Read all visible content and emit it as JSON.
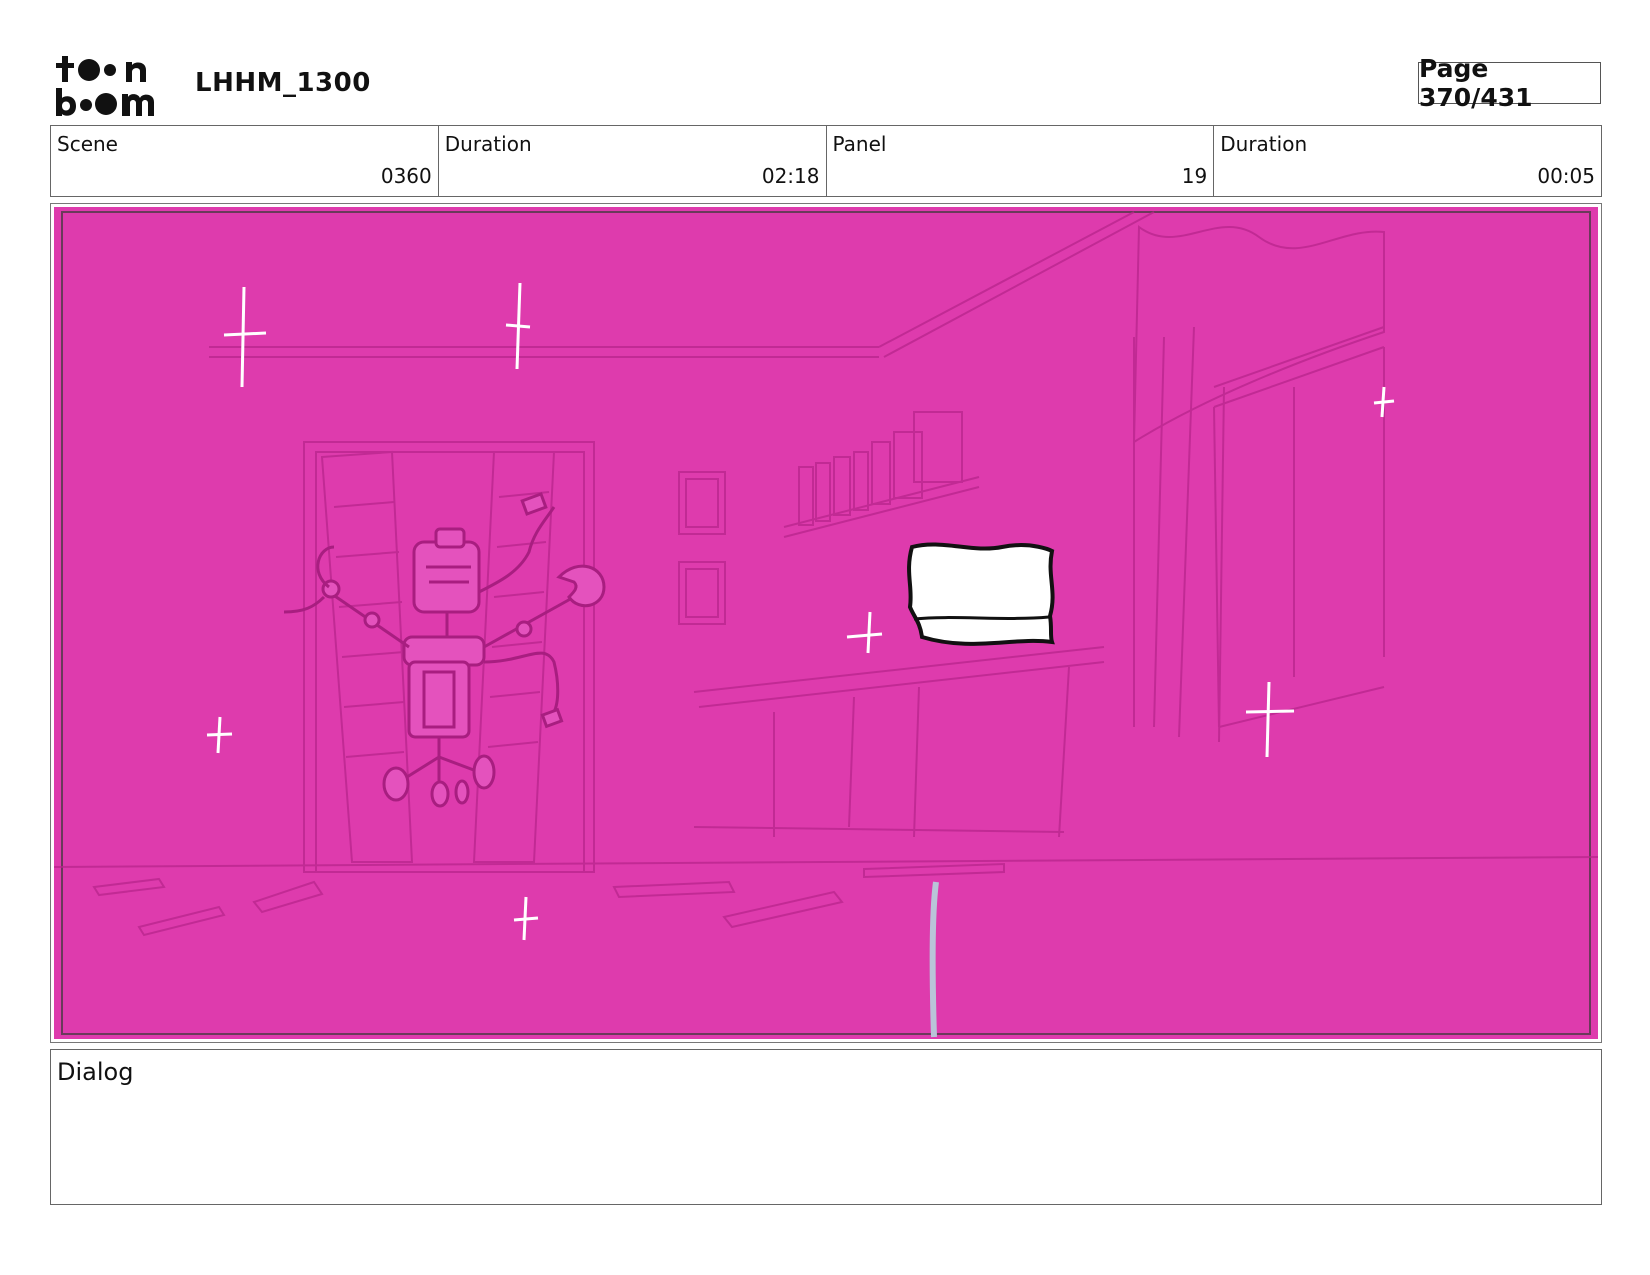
{
  "header": {
    "project_title": "LHHM_1300",
    "page_label": "Page 370/431"
  },
  "info": {
    "scene_label": "Scene",
    "scene_value": "0360",
    "scene_duration_label": "Duration",
    "scene_duration_value": "02:18",
    "panel_label": "Panel",
    "panel_value": "19",
    "panel_duration_label": "Duration",
    "panel_duration_value": "00:05"
  },
  "dialog": {
    "label": "Dialog"
  },
  "colors": {
    "panel_background": "#de3bad",
    "sketch_line": "#b8258c",
    "sparkle": "#ffffff"
  }
}
